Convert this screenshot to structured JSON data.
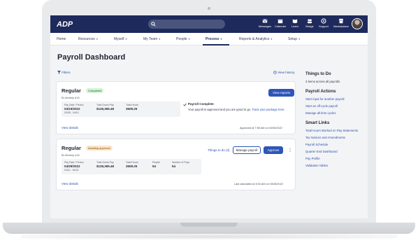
{
  "topbar": {
    "logo_text": "ADP",
    "items": [
      {
        "label": "Messages",
        "icon": "mail-icon"
      },
      {
        "label": "Calendar",
        "icon": "calendar-icon"
      },
      {
        "label": "Learn",
        "icon": "book-icon"
      },
      {
        "label": "Bridge",
        "icon": "people-icon"
      },
      {
        "label": "Support",
        "icon": "support-icon"
      },
      {
        "label": "Marketplace",
        "icon": "store-icon"
      }
    ]
  },
  "menu": {
    "items": [
      {
        "label": "Home",
        "dropdown": false
      },
      {
        "label": "Resources",
        "dropdown": true
      },
      {
        "label": "Myself",
        "dropdown": true
      },
      {
        "label": "My Team",
        "dropdown": true
      },
      {
        "label": "People",
        "dropdown": true
      },
      {
        "label": "Process",
        "dropdown": true,
        "active": true
      },
      {
        "label": "Reports & Analytics",
        "dropdown": true
      },
      {
        "label": "Setup",
        "dropdown": true
      }
    ],
    "caret": "▾"
  },
  "page": {
    "title": "Payroll Dashboard",
    "filters_label": "Filters",
    "view_history_label": "View history"
  },
  "cards": [
    {
      "title": "Regular",
      "badge": "Completed",
      "sub": "Bi-Weekly #15",
      "button": "View reports",
      "stats": [
        {
          "label": "Pay Date / Period",
          "value": "04/15/2022",
          "extra": "03/28 - 04/10"
        },
        {
          "label": "Total Gross Pay",
          "value": "$128,365.48"
        },
        {
          "label": "Total Hours",
          "value": "3608.25"
        }
      ],
      "complete_title": "Payroll Complete",
      "complete_text": "Your payroll is approved and you are good to go.",
      "track_link": "Track your package here.",
      "view_details": "View details",
      "meta": "Approved at 7:55 AM on 04/05/2022"
    },
    {
      "title": "Regular",
      "badge": "Awaiting approval",
      "sub": "Bi-Weekly #16",
      "todo": "Things to do (3)",
      "manage_button": "Manage payroll",
      "approve_button": "Approve",
      "more": "⋮",
      "stats": [
        {
          "label": "Pay Date / Period",
          "value": "04/29/2022",
          "extra": "04/11 - 04/24"
        },
        {
          "label": "Total Gross Pay",
          "value": "$128,365.48"
        },
        {
          "label": "Total Hours",
          "value": "3608.25"
        },
        {
          "label": "People",
          "value": "54"
        },
        {
          "label": "Number of Pays",
          "value": "54"
        }
      ],
      "view_details": "View details",
      "meta": "Last calculated at 5:34 AM on 03/28/2022"
    }
  ],
  "sidebar": {
    "things_heading": "Things to Do",
    "things_text": "3 items across all payrolls",
    "actions_heading": "Payroll Actions",
    "actions": [
      "Start input for another payroll",
      "Start an off-cycle payroll",
      "Manage all time cycles"
    ],
    "links_heading": "Smart Links",
    "links": [
      "Total Hours Worked on Pay Statements",
      "Tax Notices and Amendments",
      "Payroll Schedule",
      "Quarter End Dashboard",
      "Pay Profile",
      "Validation Tables"
    ]
  },
  "colors": {
    "nav_bg": "#1e2a5c",
    "primary": "#2d56b8",
    "link": "#2b4fb0",
    "completed_badge": "#d7f1d8",
    "awaiting_badge": "#fbe4c6"
  }
}
